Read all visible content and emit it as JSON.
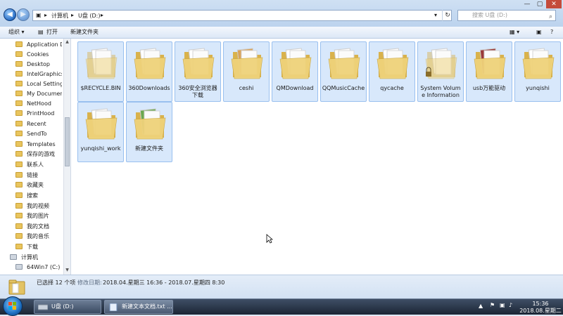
{
  "window": {
    "breadcrumb": [
      "计算机",
      "U盘 (D:)"
    ],
    "search_placeholder": "搜索 U盘 (D:)"
  },
  "toolbar": {
    "organize": "组织 ▾",
    "open": "打开",
    "new_folder": "新建文件夹"
  },
  "sidebar": {
    "items": [
      "Application D",
      "Cookies",
      "Desktop",
      "IntelGraphicsI",
      "Local Settings",
      "My Document",
      "NetHood",
      "PrintHood",
      "Recent",
      "SendTo",
      "Templates",
      "保存的游戏",
      "联系人",
      "链接",
      "收藏夹",
      "搜索",
      "我的视频",
      "我的图片",
      "我的文档",
      "我的音乐",
      "下载"
    ],
    "computer": "计算机",
    "drive": "64Win7  (C:)"
  },
  "files": [
    "$RECYCLE.BIN",
    "360Downloads",
    "360安全浏览器下载",
    "ceshi",
    "QMDownload",
    "QQMusicCache",
    "qycache",
    "System Volume Information",
    "usb万能驱动",
    "yunqishi",
    "yunqishi_work",
    "新建文件夹"
  ],
  "details": {
    "selected": "已选择 12 个项",
    "modified_label": "修改日期:",
    "modified_range": "2018.04.星期三 16:36 - 2018.07.星期四 8:30"
  },
  "taskbar": {
    "tasks": [
      "U盘 (D:)",
      "新建文本文档.txt ..."
    ],
    "time": "15:36",
    "date": "2018.08.星期二"
  },
  "colors": {
    "selection": "#d8e8fb",
    "folder": "#e9c55e",
    "taskbar": "#1b2534"
  }
}
